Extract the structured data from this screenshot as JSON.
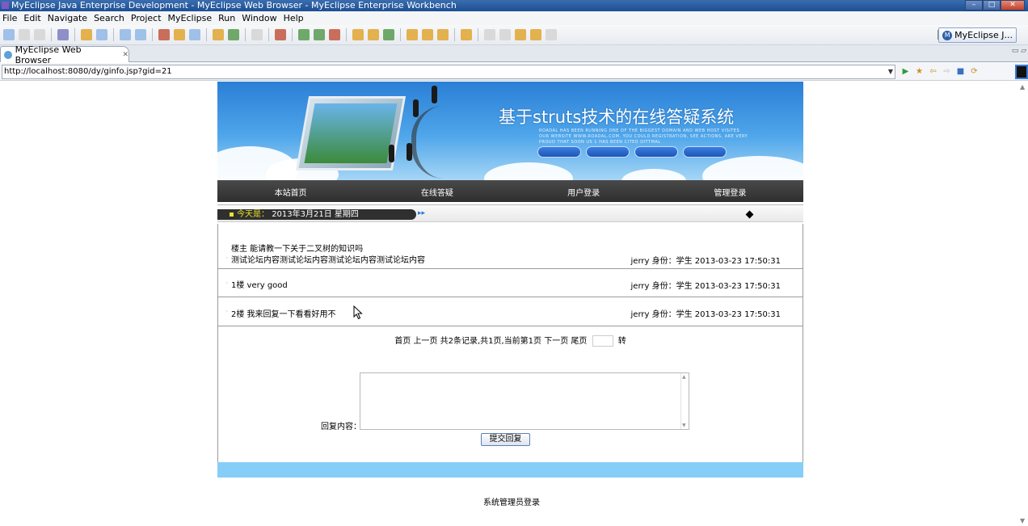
{
  "window": {
    "title": "MyEclipse Java Enterprise Development - MyEclipse Web Browser - MyEclipse Enterprise Workbench"
  },
  "menu": [
    "File",
    "Edit",
    "Navigate",
    "Search",
    "Project",
    "MyEclipse",
    "Run",
    "Window",
    "Help"
  ],
  "toolbar": {
    "perspective_label": "MyEclipse J..."
  },
  "editor_tab": {
    "label": "MyEclipse Web Browser"
  },
  "browser": {
    "url": "http://localhost:8080/dy/ginfo.jsp?gid=21"
  },
  "site": {
    "title": "基于struts技术的在线答疑系统",
    "banner_small_text": "ROADAL HAS BEEN RUNNING ONE OF THE BIGGEST DOMAIN AND WEB HOST VISITES OUR WEBSITE WWW.ROADAL.COM. YOU COULD REGISTRATION, SEE ACTIONS. ARE VERY PROUD THAT SOON US 1 HAS BEEN CITED DITTMAL",
    "nav": [
      "本站首页",
      "在线答疑",
      "用户登录",
      "管理登录"
    ],
    "date_label": "今天是：",
    "date_value": "2013年3月21日 星期四"
  },
  "posts": [
    {
      "line1": "楼主 能请教一下关于二叉树的知识吗",
      "line2": "测试论坛内容测试论坛内容测试论坛内容测试论坛内容",
      "meta": "jerry 身份：学生 2013-03-23 17:50:31"
    },
    {
      "line1": "1楼 very good",
      "meta": "jerry 身份：学生 2013-03-23 17:50:31"
    },
    {
      "line1": "2楼 我来回复一下看看好用不",
      "meta": "jerry 身份：学生 2013-03-23 17:50:31"
    }
  ],
  "pager": {
    "text": "首页 上一页 共2条记录,共1页,当前第1页 下一页 尾页",
    "go": "转",
    "page_input": ""
  },
  "reply": {
    "label": "回复内容：",
    "value": "",
    "submit": "提交回复"
  },
  "footer": {
    "admin_login": "系统管理员登录"
  }
}
